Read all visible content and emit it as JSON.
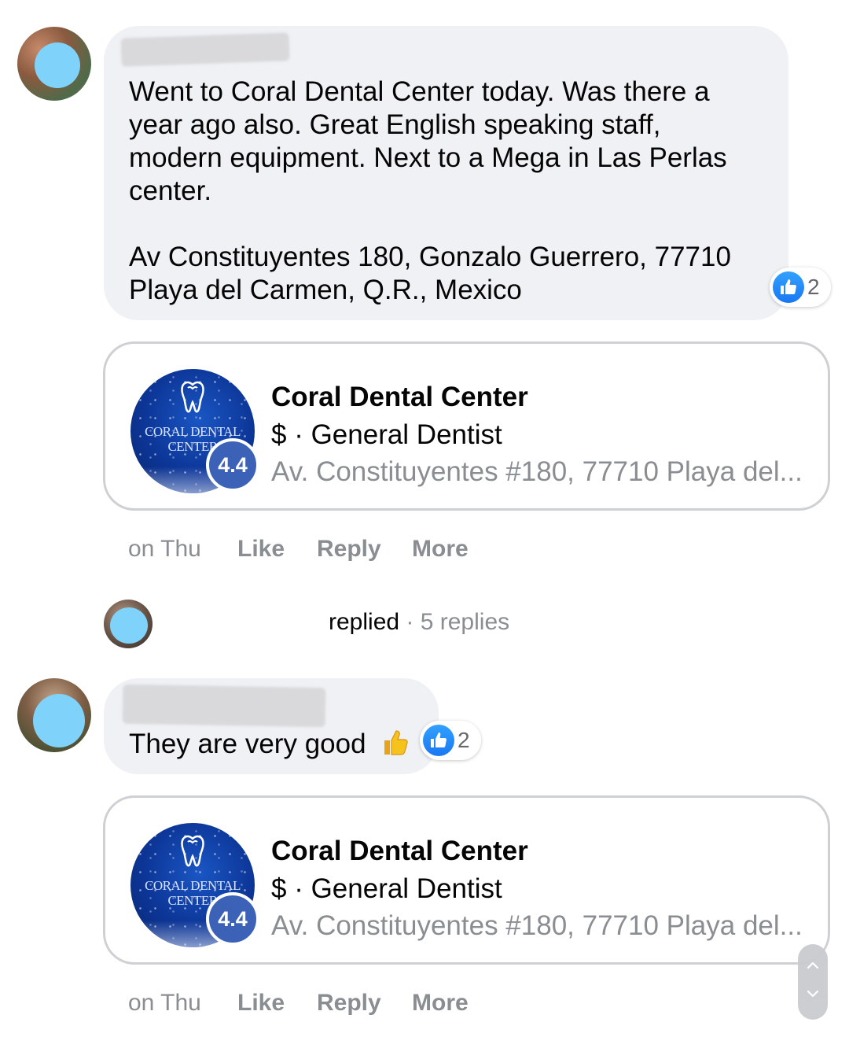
{
  "colors": {
    "bubble": "#eff1f4",
    "like_blue": "#1877f2",
    "muted_text": "#8a8d91",
    "rating_badge": "#3b62b7",
    "card_border": "#ced0d4"
  },
  "comments": [
    {
      "text": "Went to Coral Dental Center today. Was there a\nyear ago also. Great English speaking staff,\nmodern equipment. Next to a Mega in Las Perlas\ncenter.\n\nAv Constituyentes 180, Gonzalo Guerrero, 77710\nPlaya del Carmen, Q.R., Mexico",
      "reaction_count": "2",
      "place": {
        "logo_text_1": "CORAL DENTAL",
        "logo_text_2": "CENTER",
        "rating": "4.4",
        "name": "Coral Dental Center",
        "category": "$ · General Dentist",
        "address": "Av. Constituyentes #180, 77710 Playa del..."
      },
      "actions": {
        "time": "on Thu",
        "like": "Like",
        "reply": "Reply",
        "more": "More"
      }
    },
    {
      "text": "They are very good",
      "emoji": "👍",
      "reaction_count": "2",
      "place": {
        "logo_text_1": "CORAL DENTAL",
        "logo_text_2": "CENTER",
        "rating": "4.4",
        "name": "Coral Dental Center",
        "category": "$ · General Dentist",
        "address": "Av. Constituyentes #180, 77710 Playa del..."
      },
      "actions": {
        "time": "on Thu",
        "like": "Like",
        "reply": "Reply",
        "more": "More"
      }
    }
  ],
  "replies_summary": {
    "replied": "replied",
    "separator": " · ",
    "count": "5 replies"
  },
  "icons": {
    "like": "thumbs-up-icon",
    "scroll_up": "chevron-up-icon",
    "scroll_down": "chevron-down-icon"
  }
}
